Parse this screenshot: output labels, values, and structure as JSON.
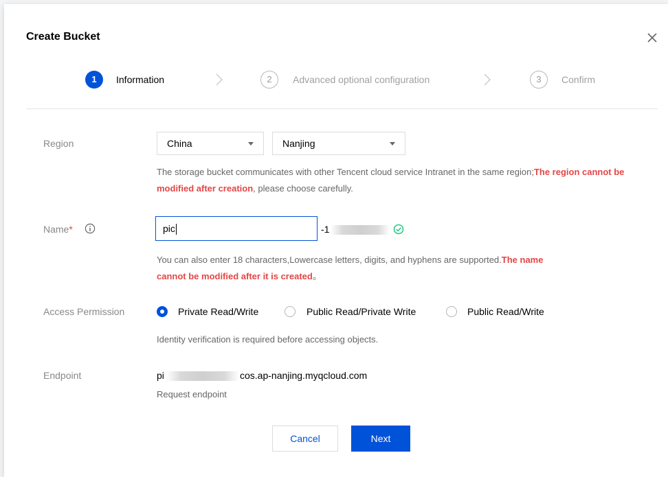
{
  "dialog": {
    "title": "Create Bucket"
  },
  "steps": [
    {
      "number": "1",
      "label": "Information",
      "state": "active"
    },
    {
      "number": "2",
      "label": "Advanced optional configuration",
      "state": "idle"
    },
    {
      "number": "3",
      "label": "Confirm",
      "state": "idle"
    }
  ],
  "region": {
    "label": "Region",
    "country_value": "China",
    "city_value": "Nanjing",
    "hint_normal_1": "The storage bucket communicates with other Tencent cloud service Intranet in the same region;",
    "hint_warn": "The region cannot be modified after creation",
    "hint_normal_2": ", please choose carefully."
  },
  "name": {
    "label": "Name",
    "required_mark": "*",
    "value": "pic",
    "suffix_prefix": "-1",
    "hint_normal": "You can also enter 18 characters,Lowercase letters, digits, and hyphens are supported.",
    "hint_warn_1": "The name",
    "hint_warn_2": "cannot be modified after it is created",
    "hint_tail": "。"
  },
  "access": {
    "label": "Access Permission",
    "options": [
      {
        "label": "Private Read/Write",
        "selected": true
      },
      {
        "label": "Public Read/Private Write",
        "selected": false
      },
      {
        "label": "Public Read/Write",
        "selected": false
      }
    ],
    "hint": "Identity verification is required before accessing objects."
  },
  "endpoint": {
    "label": "Endpoint",
    "prefix": "pi",
    "suffix": "cos.ap-nanjing.myqcloud.com",
    "sub": "Request endpoint"
  },
  "buttons": {
    "cancel": "Cancel",
    "next": "Next"
  },
  "colors": {
    "primary": "#0052d9",
    "warning": "#e54545",
    "success": "#29cc85"
  },
  "icons": {
    "close": "close-icon",
    "info": "info-icon",
    "check": "check-circle-icon",
    "chevron": "chevron-right-icon",
    "dropdown": "caret-down-icon"
  }
}
